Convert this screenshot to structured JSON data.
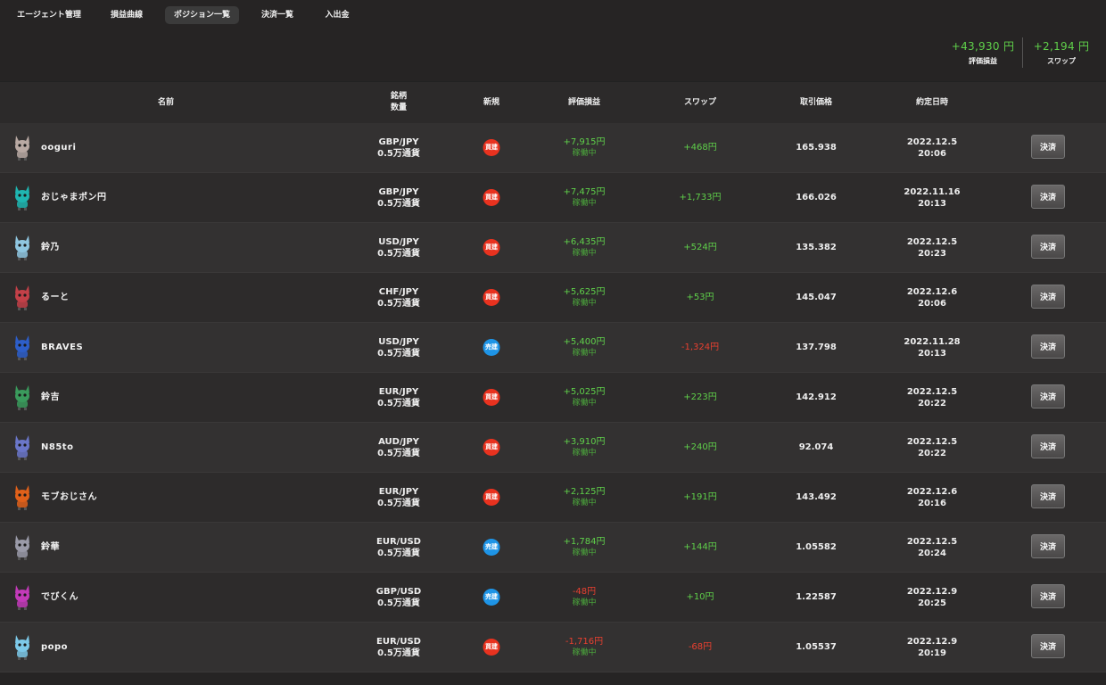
{
  "nav": {
    "tabs": [
      {
        "label": "エージェント管理"
      },
      {
        "label": "損益曲線"
      },
      {
        "label": "ポジション一覧"
      },
      {
        "label": "決済一覧"
      },
      {
        "label": "入出金"
      }
    ],
    "active_index": 2
  },
  "summary": {
    "pnl_value": "+43,930 円",
    "pnl_label": "評価損益",
    "swap_value": "+2,194 円",
    "swap_label": "スワップ"
  },
  "table": {
    "headers": {
      "name": "名前",
      "symbol": "銘柄",
      "quantity": "数量",
      "new": "新規",
      "pnl": "評価損益",
      "swap": "スワップ",
      "price": "取引価格",
      "datetime": "約定日時"
    },
    "settle_label": "決済",
    "rows": [
      {
        "name": "ooguri",
        "avatar": "rabbit-avatar-icon",
        "color": "#b9a9a3",
        "pair": "GBP/JPY",
        "qty": "0.5万通貨",
        "side": "買建",
        "side_type": "buy",
        "pnl": "+7,915円",
        "pnl_sign": "pos",
        "status": "稼働中",
        "swap": "+468円",
        "swap_sign": "pos",
        "price": "165.938",
        "date": "2022.12.5",
        "time": "20:06"
      },
      {
        "name": "おじゃまポン円",
        "avatar": "cat-avatar-icon",
        "color": "#1fb5b0",
        "pair": "GBP/JPY",
        "qty": "0.5万通貨",
        "side": "買建",
        "side_type": "buy",
        "pnl": "+7,475円",
        "pnl_sign": "pos",
        "status": "稼働中",
        "swap": "+1,733円",
        "swap_sign": "pos",
        "price": "166.026",
        "date": "2022.11.16",
        "time": "20:13"
      },
      {
        "name": "鈴乃",
        "avatar": "ghost-avatar-icon",
        "color": "#8fc6e0",
        "pair": "USD/JPY",
        "qty": "0.5万通貨",
        "side": "買建",
        "side_type": "buy",
        "pnl": "+6,435円",
        "pnl_sign": "pos",
        "status": "稼働中",
        "swap": "+524円",
        "swap_sign": "pos",
        "price": "135.382",
        "date": "2022.12.5",
        "time": "20:23"
      },
      {
        "name": "るーと",
        "avatar": "fox-avatar-icon",
        "color": "#c24048",
        "pair": "CHF/JPY",
        "qty": "0.5万通貨",
        "side": "買建",
        "side_type": "buy",
        "pnl": "+5,625円",
        "pnl_sign": "pos",
        "status": "稼働中",
        "swap": "+53円",
        "swap_sign": "pos",
        "price": "145.047",
        "date": "2022.12.6",
        "time": "20:06"
      },
      {
        "name": "BRAVES",
        "avatar": "octopus-avatar-icon",
        "color": "#2d5ec9",
        "pair": "USD/JPY",
        "qty": "0.5万通貨",
        "side": "売建",
        "side_type": "sell",
        "pnl": "+5,400円",
        "pnl_sign": "pos",
        "status": "稼働中",
        "swap": "-1,324円",
        "swap_sign": "neg",
        "price": "137.798",
        "date": "2022.11.28",
        "time": "20:13"
      },
      {
        "name": "鈴吉",
        "avatar": "bear-avatar-icon",
        "color": "#3a9a5c",
        "pair": "EUR/JPY",
        "qty": "0.5万通貨",
        "side": "買建",
        "side_type": "buy",
        "pnl": "+5,025円",
        "pnl_sign": "pos",
        "status": "稼働中",
        "swap": "+223円",
        "swap_sign": "pos",
        "price": "142.912",
        "date": "2022.12.5",
        "time": "20:22"
      },
      {
        "name": "N85to",
        "avatar": "wolf-avatar-icon",
        "color": "#6a76c8",
        "pair": "AUD/JPY",
        "qty": "0.5万通貨",
        "side": "買建",
        "side_type": "buy",
        "pnl": "+3,910円",
        "pnl_sign": "pos",
        "status": "稼働中",
        "swap": "+240円",
        "swap_sign": "pos",
        "price": "92.074",
        "date": "2022.12.5",
        "time": "20:22"
      },
      {
        "name": "モブおじさん",
        "avatar": "octopus-avatar-icon",
        "color": "#e0601a",
        "pair": "EUR/JPY",
        "qty": "0.5万通貨",
        "side": "買建",
        "side_type": "buy",
        "pnl": "+2,125円",
        "pnl_sign": "pos",
        "status": "稼働中",
        "swap": "+191円",
        "swap_sign": "pos",
        "price": "143.492",
        "date": "2022.12.6",
        "time": "20:16"
      },
      {
        "name": "鈴華",
        "avatar": "mouse-avatar-icon",
        "color": "#9a9aa8",
        "pair": "EUR/USD",
        "qty": "0.5万通貨",
        "side": "売建",
        "side_type": "sell",
        "pnl": "+1,784円",
        "pnl_sign": "pos",
        "status": "稼働中",
        "swap": "+144円",
        "swap_sign": "pos",
        "price": "1.05582",
        "date": "2022.12.5",
        "time": "20:24"
      },
      {
        "name": "でびくん",
        "avatar": "octopus-avatar-icon",
        "color": "#c23ab8",
        "pair": "GBP/USD",
        "qty": "0.5万通貨",
        "side": "売建",
        "side_type": "sell",
        "pnl": "-48円",
        "pnl_sign": "neg",
        "status": "稼働中",
        "swap": "+10円",
        "swap_sign": "pos",
        "price": "1.22587",
        "date": "2022.12.9",
        "time": "20:25"
      },
      {
        "name": "popo",
        "avatar": "bird-avatar-icon",
        "color": "#7cc8e8",
        "pair": "EUR/USD",
        "qty": "0.5万通貨",
        "side": "買建",
        "side_type": "buy",
        "pnl": "-1,716円",
        "pnl_sign": "neg",
        "status": "稼働中",
        "swap": "-68円",
        "swap_sign": "neg",
        "price": "1.05537",
        "date": "2022.12.9",
        "time": "20:19"
      }
    ]
  }
}
